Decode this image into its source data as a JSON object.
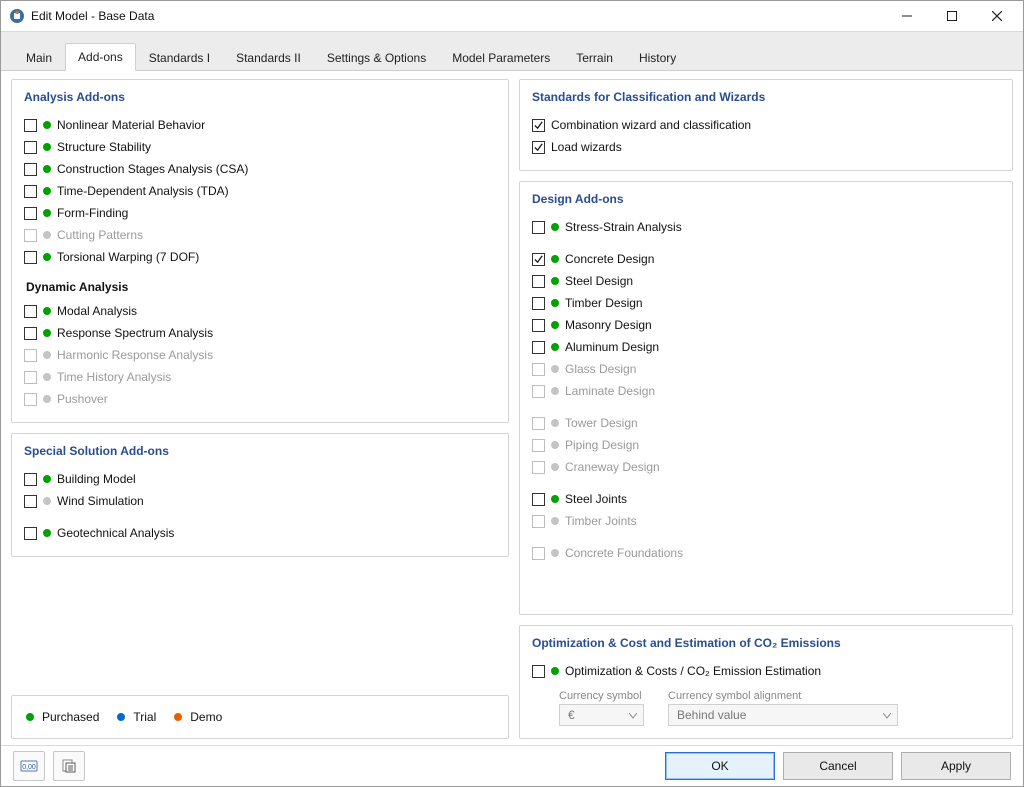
{
  "window": {
    "title": "Edit Model - Base Data"
  },
  "tabs": {
    "items": [
      "Main",
      "Add-ons",
      "Standards I",
      "Standards II",
      "Settings & Options",
      "Model Parameters",
      "Terrain",
      "History"
    ],
    "active_index": 1
  },
  "legend": {
    "purchased": "Purchased",
    "trial": "Trial",
    "demo": "Demo"
  },
  "buttons": {
    "ok": "OK",
    "cancel": "Cancel",
    "apply": "Apply"
  },
  "sections": {
    "analysis": {
      "title": "Analysis Add-ons",
      "items": [
        {
          "label": "Nonlinear Material Behavior",
          "status": "green",
          "checked": false,
          "disabled": false
        },
        {
          "label": "Structure Stability",
          "status": "green",
          "checked": false,
          "disabled": false
        },
        {
          "label": "Construction Stages Analysis (CSA)",
          "status": "green",
          "checked": false,
          "disabled": false
        },
        {
          "label": "Time-Dependent Analysis (TDA)",
          "status": "green",
          "checked": false,
          "disabled": false
        },
        {
          "label": "Form-Finding",
          "status": "green",
          "checked": false,
          "disabled": false
        },
        {
          "label": "Cutting Patterns",
          "status": "grey",
          "checked": false,
          "disabled": true
        },
        {
          "label": "Torsional Warping (7 DOF)",
          "status": "green",
          "checked": false,
          "disabled": false
        }
      ],
      "dynamic_title": "Dynamic Analysis",
      "dynamic_items": [
        {
          "label": "Modal Analysis",
          "status": "green",
          "checked": false,
          "disabled": false
        },
        {
          "label": "Response Spectrum Analysis",
          "status": "green",
          "checked": false,
          "disabled": false
        },
        {
          "label": "Harmonic Response Analysis",
          "status": "grey",
          "checked": false,
          "disabled": true
        },
        {
          "label": "Time History Analysis",
          "status": "grey",
          "checked": false,
          "disabled": true
        },
        {
          "label": "Pushover",
          "status": "grey",
          "checked": false,
          "disabled": true
        }
      ]
    },
    "special": {
      "title": "Special Solution Add-ons",
      "items": [
        {
          "label": "Building Model",
          "status": "green",
          "checked": false,
          "disabled": false
        },
        {
          "label": "Wind Simulation",
          "status": "grey",
          "checked": false,
          "disabled": false
        }
      ],
      "items2": [
        {
          "label": "Geotechnical Analysis",
          "status": "green",
          "checked": false,
          "disabled": false
        }
      ]
    },
    "standards": {
      "title": "Standards for Classification and Wizards",
      "items": [
        {
          "label": "Combination wizard and classification",
          "checked": true,
          "disabled": false,
          "dot": null
        },
        {
          "label": "Load wizards",
          "checked": true,
          "disabled": false,
          "dot": null
        }
      ]
    },
    "design": {
      "title": "Design Add-ons",
      "groups": [
        [
          {
            "label": "Stress-Strain Analysis",
            "status": "green",
            "checked": false,
            "disabled": false
          }
        ],
        [
          {
            "label": "Concrete Design",
            "status": "green",
            "checked": true,
            "disabled": false
          },
          {
            "label": "Steel Design",
            "status": "green",
            "checked": false,
            "disabled": false
          },
          {
            "label": "Timber Design",
            "status": "green",
            "checked": false,
            "disabled": false
          },
          {
            "label": "Masonry Design",
            "status": "green",
            "checked": false,
            "disabled": false
          },
          {
            "label": "Aluminum Design",
            "status": "green",
            "checked": false,
            "disabled": false
          },
          {
            "label": "Glass Design",
            "status": "grey",
            "checked": false,
            "disabled": true
          },
          {
            "label": "Laminate Design",
            "status": "grey",
            "checked": false,
            "disabled": true
          }
        ],
        [
          {
            "label": "Tower Design",
            "status": "grey",
            "checked": false,
            "disabled": true
          },
          {
            "label": "Piping Design",
            "status": "grey",
            "checked": false,
            "disabled": true
          },
          {
            "label": "Craneway Design",
            "status": "grey",
            "checked": false,
            "disabled": true
          }
        ],
        [
          {
            "label": "Steel Joints",
            "status": "green",
            "checked": false,
            "disabled": false
          },
          {
            "label": "Timber Joints",
            "status": "grey",
            "checked": false,
            "disabled": true
          }
        ],
        [
          {
            "label": "Concrete Foundations",
            "status": "grey",
            "checked": false,
            "disabled": true
          }
        ]
      ]
    },
    "optimization": {
      "title": "Optimization & Cost and Estimation of CO₂ Emissions",
      "item_label": "Optimization & Costs / CO₂ Emission Estimation",
      "item_status": "green",
      "currency_label": "Currency symbol",
      "currency_value": "€",
      "alignment_label": "Currency symbol alignment",
      "alignment_value": "Behind value"
    }
  }
}
